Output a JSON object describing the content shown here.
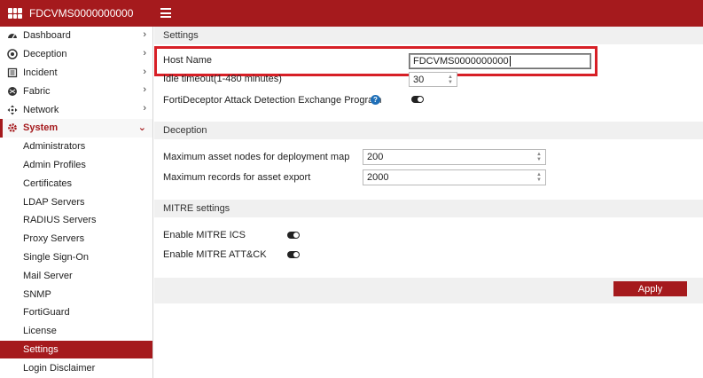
{
  "app": {
    "title": "FDCVMS0000000000"
  },
  "sidebar": {
    "top_items": [
      {
        "label": "Dashboard",
        "icon": "dashboard-icon"
      },
      {
        "label": "Deception",
        "icon": "deception-icon"
      },
      {
        "label": "Incident",
        "icon": "incident-icon"
      },
      {
        "label": "Fabric",
        "icon": "fabric-icon"
      },
      {
        "label": "Network",
        "icon": "network-icon"
      }
    ],
    "system": {
      "label": "System",
      "icon": "gear-icon"
    },
    "sub_items": [
      "Administrators",
      "Admin Profiles",
      "Certificates",
      "LDAP Servers",
      "RADIUS Servers",
      "Proxy Servers",
      "Single Sign-On",
      "Mail Server",
      "SNMP",
      "FortiGuard",
      "License",
      "Settings",
      "Login Disclaimer"
    ],
    "active_item": "Settings"
  },
  "settings": {
    "section_title": "Settings",
    "host_name_label": "Host Name",
    "host_name_value": "FDCVMS0000000000",
    "idle_timeout_label": "Idle timeout(1-480 minutes)",
    "idle_timeout_value": "30",
    "attack_program_label": "FortiDeceptor Attack Detection Exchange Program",
    "attack_program_enabled": false
  },
  "deception": {
    "section_title": "Deception",
    "max_nodes_label": "Maximum asset nodes for deployment map",
    "max_nodes_value": "200",
    "max_records_label": "Maximum records for asset export",
    "max_records_value": "2000"
  },
  "mitre": {
    "section_title": "MITRE settings",
    "ics_label": "Enable MITRE ICS",
    "ics_enabled": false,
    "attck_label": "Enable MITRE ATT&CK",
    "attck_enabled": false
  },
  "footer": {
    "apply_label": "Apply"
  },
  "colors": {
    "brand": "#a51a1d",
    "highlight": "#d71f26",
    "help": "#1e6fb8"
  }
}
